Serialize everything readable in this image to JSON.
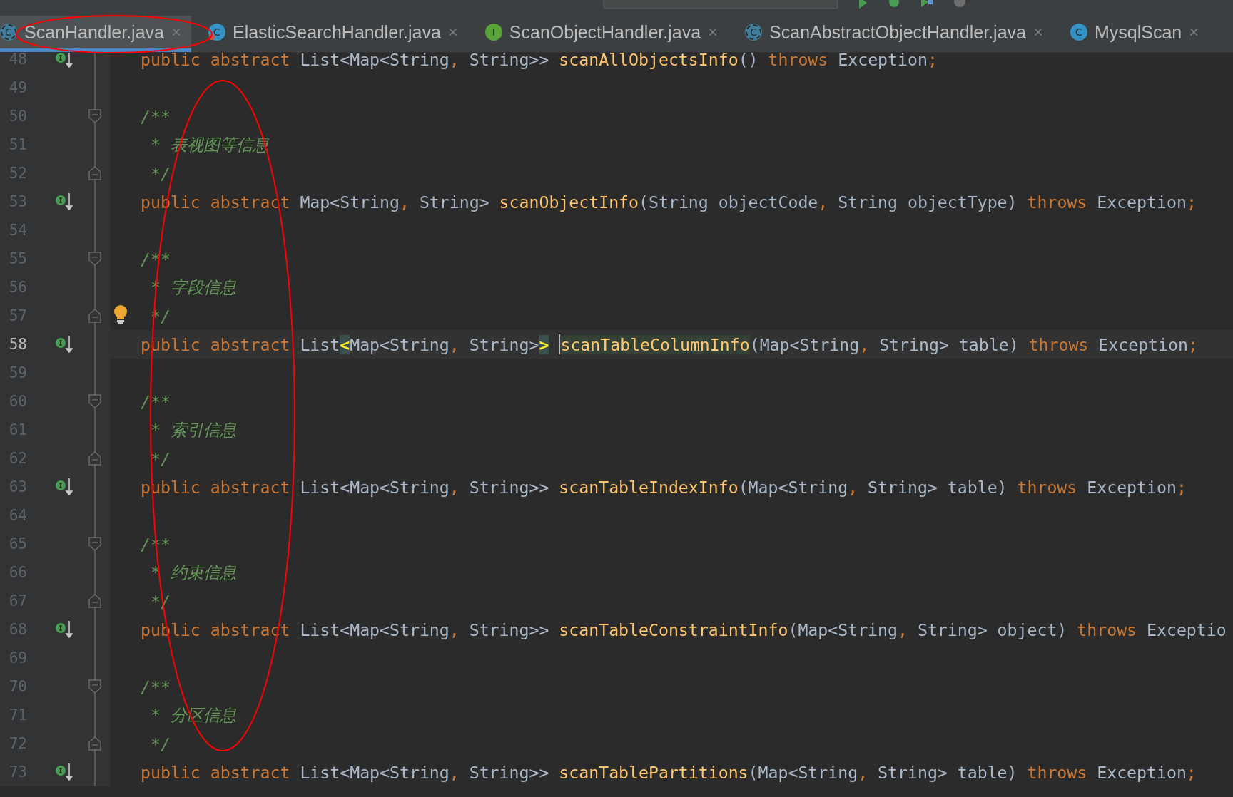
{
  "tabs": [
    {
      "label": "ScanHandler.java",
      "kind": "abstract-class",
      "icon_letter": "C",
      "selected": true
    },
    {
      "label": "ElasticSearchHandler.java",
      "kind": "class-error",
      "icon_letter": "C",
      "selected": false
    },
    {
      "label": "ScanObjectHandler.java",
      "kind": "interface",
      "icon_letter": "I",
      "selected": false
    },
    {
      "label": "ScanAbstractObjectHandler.java",
      "kind": "abstract-class",
      "icon_letter": "C",
      "selected": false
    },
    {
      "label": "MysqlScan",
      "kind": "class",
      "icon_letter": "C",
      "selected": false
    }
  ],
  "close_glyph": "×",
  "lines": [
    {
      "number": "48",
      "current": false,
      "gutter_icons": [
        {
          "kind": "implements"
        }
      ],
      "tokens": [
        {
          "kind": "keyword",
          "text": "public abstract "
        },
        {
          "kind": "plain",
          "text": "List<Map<String"
        },
        {
          "kind": "punct",
          "text": ", "
        },
        {
          "kind": "plain",
          "text": "String>> "
        },
        {
          "kind": "method",
          "text": "scanAllObjectsInfo"
        },
        {
          "kind": "plain",
          "text": "() "
        },
        {
          "kind": "keyword",
          "text": "throws "
        },
        {
          "kind": "plain",
          "text": "Exception"
        },
        {
          "kind": "punct",
          "text": ";"
        }
      ]
    },
    {
      "number": "49",
      "current": false
    },
    {
      "number": "50",
      "current": false,
      "gutter_icons": [
        {
          "kind": "fold-open"
        }
      ],
      "tokens": [
        {
          "kind": "comment",
          "text": "/**"
        }
      ]
    },
    {
      "number": "51",
      "current": false,
      "tokens": [
        {
          "kind": "comment",
          "text": " * 表视图等信息"
        }
      ]
    },
    {
      "number": "52",
      "current": false,
      "gutter_icons": [
        {
          "kind": "fold-close"
        }
      ],
      "tokens": [
        {
          "kind": "comment",
          "text": " */"
        }
      ]
    },
    {
      "number": "53",
      "current": false,
      "gutter_icons": [
        {
          "kind": "implements"
        }
      ],
      "tokens": [
        {
          "kind": "keyword",
          "text": "public abstract "
        },
        {
          "kind": "plain",
          "text": "Map<String"
        },
        {
          "kind": "punct",
          "text": ", "
        },
        {
          "kind": "plain",
          "text": "String> "
        },
        {
          "kind": "method",
          "text": "scanObjectInfo"
        },
        {
          "kind": "plain",
          "text": "(String objectCode"
        },
        {
          "kind": "punct",
          "text": ", "
        },
        {
          "kind": "plain",
          "text": "String objectType) "
        },
        {
          "kind": "keyword",
          "text": "throws "
        },
        {
          "kind": "plain",
          "text": "Exception"
        },
        {
          "kind": "punct",
          "text": ";"
        }
      ]
    },
    {
      "number": "54",
      "current": false
    },
    {
      "number": "55",
      "current": false,
      "gutter_icons": [
        {
          "kind": "fold-open"
        }
      ],
      "tokens": [
        {
          "kind": "comment",
          "text": "/**"
        }
      ]
    },
    {
      "number": "56",
      "current": false,
      "tokens": [
        {
          "kind": "comment",
          "text": " * 字段信息"
        }
      ]
    },
    {
      "number": "57",
      "current": false,
      "gutter_icons": [
        {
          "kind": "fold-close"
        },
        {
          "kind": "bulb"
        }
      ],
      "tokens": [
        {
          "kind": "comment",
          "text": " */"
        }
      ]
    },
    {
      "number": "58",
      "current": true,
      "gutter_icons": [
        {
          "kind": "implements"
        }
      ],
      "tokens": [
        {
          "kind": "keyword",
          "text": "public abstract "
        },
        {
          "kind": "plain",
          "text": "List"
        },
        {
          "kind": "brace-match",
          "text": "<"
        },
        {
          "kind": "plain",
          "text": "Map<String"
        },
        {
          "kind": "punct",
          "text": ", "
        },
        {
          "kind": "plain",
          "text": "String>"
        },
        {
          "kind": "brace-match",
          "text": ">"
        },
        {
          "kind": "usage",
          "text": "scanTableColumnInfo"
        },
        {
          "kind": "plain",
          "text": "(Map<String"
        },
        {
          "kind": "punct",
          "text": ", "
        },
        {
          "kind": "plain",
          "text": "String> table) "
        },
        {
          "kind": "keyword",
          "text": "throws "
        },
        {
          "kind": "plain",
          "text": "Exception"
        },
        {
          "kind": "punct",
          "text": ";"
        }
      ]
    },
    {
      "number": "59",
      "current": false
    },
    {
      "number": "60",
      "current": false,
      "gutter_icons": [
        {
          "kind": "fold-open"
        }
      ],
      "tokens": [
        {
          "kind": "comment",
          "text": "/**"
        }
      ]
    },
    {
      "number": "61",
      "current": false,
      "tokens": [
        {
          "kind": "comment",
          "text": " * 索引信息"
        }
      ]
    },
    {
      "number": "62",
      "current": false,
      "gutter_icons": [
        {
          "kind": "fold-close"
        }
      ],
      "tokens": [
        {
          "kind": "comment",
          "text": " */"
        }
      ]
    },
    {
      "number": "63",
      "current": false,
      "gutter_icons": [
        {
          "kind": "implements"
        }
      ],
      "tokens": [
        {
          "kind": "keyword",
          "text": "public abstract "
        },
        {
          "kind": "plain",
          "text": "List<Map<String"
        },
        {
          "kind": "punct",
          "text": ", "
        },
        {
          "kind": "plain",
          "text": "String>> "
        },
        {
          "kind": "method",
          "text": "scanTableIndexInfo"
        },
        {
          "kind": "plain",
          "text": "(Map<String"
        },
        {
          "kind": "punct",
          "text": ", "
        },
        {
          "kind": "plain",
          "text": "String> table) "
        },
        {
          "kind": "keyword",
          "text": "throws "
        },
        {
          "kind": "plain",
          "text": "Exception"
        },
        {
          "kind": "punct",
          "text": ";"
        }
      ]
    },
    {
      "number": "64",
      "current": false
    },
    {
      "number": "65",
      "current": false,
      "gutter_icons": [
        {
          "kind": "fold-open"
        }
      ],
      "tokens": [
        {
          "kind": "comment",
          "text": "/**"
        }
      ]
    },
    {
      "number": "66",
      "current": false,
      "tokens": [
        {
          "kind": "comment",
          "text": " * 约束信息"
        }
      ]
    },
    {
      "number": "67",
      "current": false,
      "gutter_icons": [
        {
          "kind": "fold-close"
        }
      ],
      "tokens": [
        {
          "kind": "comment",
          "text": " */"
        }
      ]
    },
    {
      "number": "68",
      "current": false,
      "gutter_icons": [
        {
          "kind": "implements"
        }
      ],
      "tokens": [
        {
          "kind": "keyword",
          "text": "public abstract "
        },
        {
          "kind": "plain",
          "text": "List<Map<String"
        },
        {
          "kind": "punct",
          "text": ", "
        },
        {
          "kind": "plain",
          "text": "String>> "
        },
        {
          "kind": "method",
          "text": "scanTableConstraintInfo"
        },
        {
          "kind": "plain",
          "text": "(Map<String"
        },
        {
          "kind": "punct",
          "text": ", "
        },
        {
          "kind": "plain",
          "text": "String> object) "
        },
        {
          "kind": "keyword",
          "text": "throws "
        },
        {
          "kind": "plain",
          "text": "Exceptio"
        }
      ]
    },
    {
      "number": "69",
      "current": false
    },
    {
      "number": "70",
      "current": false,
      "gutter_icons": [
        {
          "kind": "fold-open"
        }
      ],
      "tokens": [
        {
          "kind": "comment",
          "text": "/**"
        }
      ]
    },
    {
      "number": "71",
      "current": false,
      "tokens": [
        {
          "kind": "comment",
          "text": " * 分区信息"
        }
      ]
    },
    {
      "number": "72",
      "current": false,
      "gutter_icons": [
        {
          "kind": "fold-close"
        }
      ],
      "tokens": [
        {
          "kind": "comment",
          "text": " */"
        }
      ]
    },
    {
      "number": "73",
      "current": false,
      "gutter_icons": [
        {
          "kind": "implements"
        }
      ],
      "tokens": [
        {
          "kind": "keyword",
          "text": "public abstract "
        },
        {
          "kind": "plain",
          "text": "List<Map<String"
        },
        {
          "kind": "punct",
          "text": ", "
        },
        {
          "kind": "plain",
          "text": "String>> "
        },
        {
          "kind": "method",
          "text": "scanTablePartitions"
        },
        {
          "kind": "plain",
          "text": "(Map<String"
        },
        {
          "kind": "punct",
          "text": ", "
        },
        {
          "kind": "plain",
          "text": "String> table) "
        },
        {
          "kind": "keyword",
          "text": "throws "
        },
        {
          "kind": "plain",
          "text": "Exception"
        },
        {
          "kind": "punct",
          "text": ";"
        }
      ]
    }
  ]
}
